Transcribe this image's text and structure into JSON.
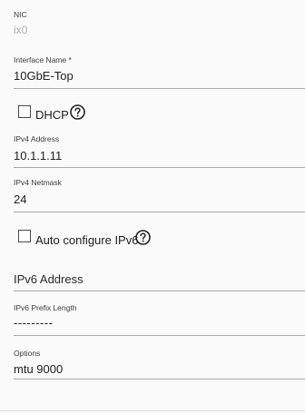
{
  "nic": {
    "label": "NIC",
    "value": "ix0"
  },
  "interface_name": {
    "label": "Interface Name *",
    "value": "10GbE-Top"
  },
  "dhcp": {
    "label": "DHCP",
    "checked": false
  },
  "ipv4_address": {
    "label": "IPv4 Address",
    "value": "10.1.1.11"
  },
  "ipv4_netmask": {
    "label": "IPv4 Netmask",
    "value": "24"
  },
  "auto_ipv6": {
    "label": "Auto configure IPv6",
    "checked": false
  },
  "ipv6_address": {
    "placeholder": "IPv6 Address",
    "value": ""
  },
  "ipv6_prefix": {
    "label": "IPv6 Prefix Length",
    "value": "---------"
  },
  "options": {
    "label": "Options",
    "value": "mtu 9000"
  },
  "icons": {
    "help": "help-circle-icon"
  }
}
